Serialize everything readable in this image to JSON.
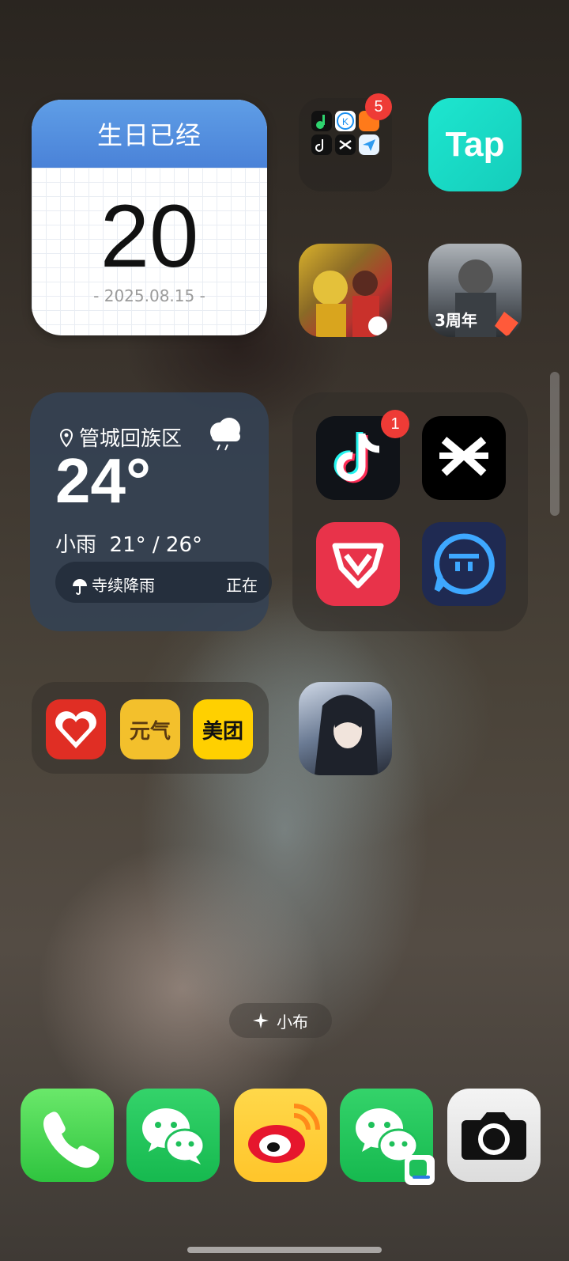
{
  "calendar_widget": {
    "header": "生日已经",
    "number": "20",
    "date": "- 2025.08.15 -"
  },
  "folder": {
    "badge": "5",
    "icons": [
      "music-app-icon",
      "k-app-icon",
      "video-app-icon",
      "tiktok-app-icon",
      "capcut-app-icon",
      "send-app-icon"
    ]
  },
  "apps": {
    "tap_label": "Tap",
    "game2_label": "3周年"
  },
  "weather_widget": {
    "location": "管城回族区",
    "temperature": "24°",
    "condition": "小雨",
    "range": "21° / 26°",
    "alert": "寺续降雨",
    "status": "正在"
  },
  "stack_group": {
    "tiktok_badge": "1"
  },
  "shopping_group": {
    "yuanqi": "元气",
    "meituan": "美团"
  },
  "assistant": {
    "label": "小布"
  },
  "dock": [
    "phone-app",
    "wechat-app",
    "weibo-app",
    "wechat-clone-app",
    "camera-app"
  ]
}
